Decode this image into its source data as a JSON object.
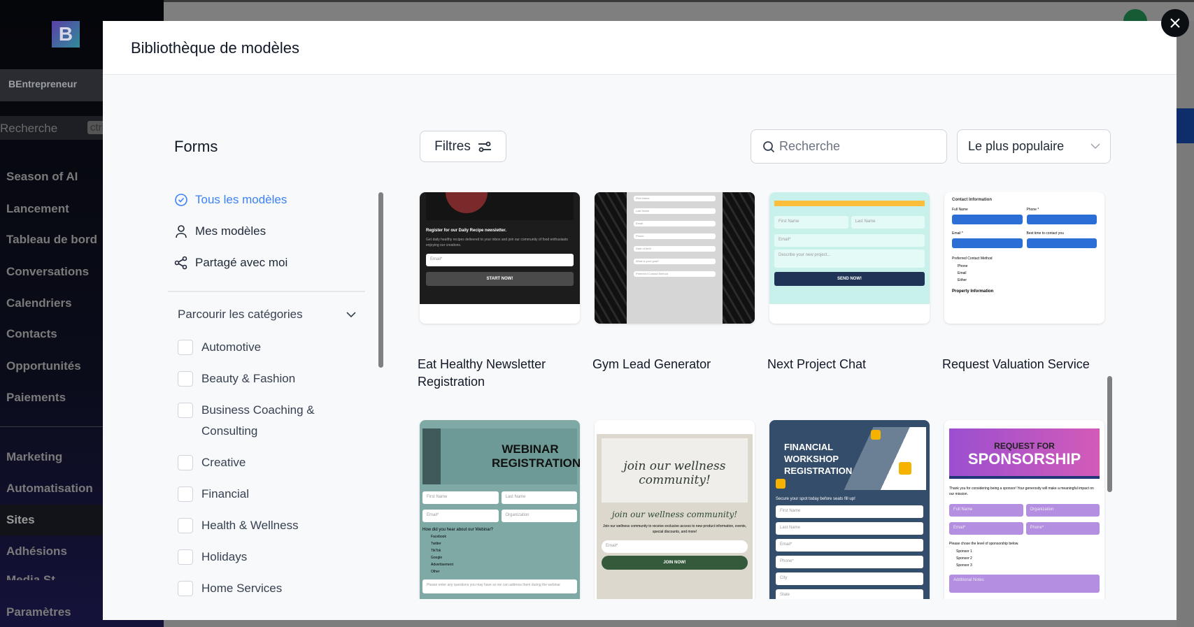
{
  "app": {
    "account": "BEntrepreneur",
    "search_placeholder": "Recherche",
    "search_shortcut": "ctrl",
    "nav": [
      "Season of AI",
      "Lancement",
      "Tableau de bord",
      "Conversations",
      "Calendriers",
      "Contacts",
      "Opportunités",
      "Paiements"
    ],
    "nav2": [
      "Marketing",
      "Automatisation",
      "Sites",
      "Adhésions",
      "Media St"
    ],
    "settings": "Paramètres",
    "active": "Sites"
  },
  "modal": {
    "title": "Bibliothèque de modèles",
    "section": "Forms",
    "filters_label": "Filtres",
    "search_placeholder": "Recherche",
    "sort_value": "Le plus populaire",
    "menu": [
      {
        "label": "Tous les modèles",
        "icon": "check-badge-icon",
        "active": true
      },
      {
        "label": "Mes modèles",
        "icon": "user-icon"
      },
      {
        "label": "Partagé avec moi",
        "icon": "share-icon"
      }
    ],
    "categories_heading": "Parcourir les catégories",
    "categories": [
      "Automotive",
      "Beauty & Fashion",
      "Business Coaching & Consulting",
      "Creative",
      "Financial",
      "Health & Wellness",
      "Holidays",
      "Home Services"
    ],
    "templates": [
      {
        "title": "Eat Healthy Newsletter Registration",
        "thumb": {
          "heading": "Register for our Daily Recipe newsletter.",
          "sub": "Get daily healthy recipes delivered to your inbox and join our community of food enthusiasts enjoying our creations.",
          "field": "Email*",
          "button": "START NOW!"
        }
      },
      {
        "title": "Gym Lead Generator",
        "thumb": {
          "fields": [
            "First Name",
            "Last Name",
            "Email",
            "Phone",
            "Date of birth",
            "What is your goal?",
            "Preferred Contact Method"
          ]
        }
      },
      {
        "title": "Next Project Chat",
        "thumb": {
          "fields": [
            "First Name",
            "Last Name",
            "Email*",
            "Describe your new project..."
          ],
          "button": "SEND NOW!"
        }
      },
      {
        "title": "Request Valuation Service",
        "thumb": {
          "heading": "Contact Information",
          "labels": [
            "Full Name",
            "Phone *",
            "Email *",
            "Best time to contact you"
          ],
          "method": "Preferred Contact Method",
          "options": [
            "Phone",
            "Email",
            "Either"
          ],
          "footer": "Property Information"
        }
      },
      {
        "title": "Webinar Registration",
        "thumb": {
          "heading": "WEBINAR REGISTRATION",
          "fields": [
            "First Name",
            "Last Name",
            "Email*",
            "Organization"
          ],
          "question": "How did you hear about our Webinar?",
          "options": [
            "Facebook",
            "Twitter",
            "TikTok",
            "Google",
            "Advertisement",
            "Other"
          ],
          "footer": "Please enter any questions you may have so we can address them during the webinar."
        }
      },
      {
        "title": "Wellness Community",
        "thumb": {
          "heading": "join our wellness community!",
          "sub": "Join our wellness community to receive exclusive access to new product information, events, special discounts, and more!",
          "field": "Email*",
          "button": "JOIN NOW!"
        }
      },
      {
        "title": "Financial Workshop Registration",
        "thumb": {
          "heading": "FINANCIAL WORKSHOP REGISTRATION",
          "sub": "Secure your spot today before seats fill up!",
          "fields": [
            "First Name",
            "Last Name",
            "Email*",
            "Phone*",
            "City",
            "State"
          ]
        }
      },
      {
        "title": "Request for Sponsorship",
        "thumb": {
          "heading1": "REQUEST FOR",
          "heading2": "SPONSORSHIP",
          "sub": "Thank you for considering being a sponsor! Your generosity will make a meaningful impact on our mission.",
          "fields": [
            "Full Name",
            "Organization",
            "Email*",
            "Phone*"
          ],
          "question": "Please chose the level of sponsorship below.",
          "options": [
            "Sponsor 1",
            "Sponsor 2",
            "Sponsor 3"
          ],
          "notes": "Additional Notes"
        }
      }
    ]
  },
  "colors": {
    "accent": "#3b82f6",
    "sidebar": "#05060a",
    "overlay": "#7f7f7f"
  }
}
